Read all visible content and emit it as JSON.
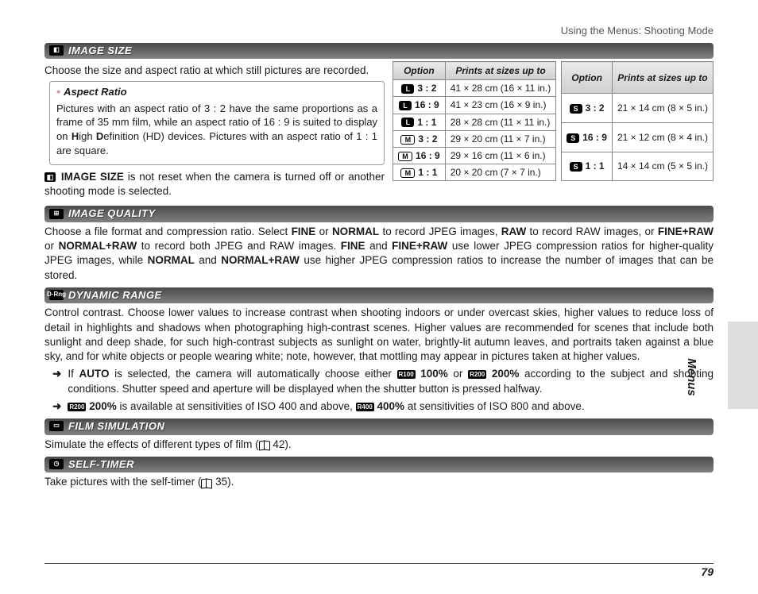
{
  "header": {
    "breadcrumb": "Using the Menus: Shooting Mode"
  },
  "side_tab": "Menus",
  "page_number": "79",
  "sections": {
    "image_size": {
      "title": "IMAGE SIZE",
      "intro": "Choose the size and aspect ratio at which still pictures are recorded.",
      "callout": {
        "title": "Aspect Ratio",
        "body_parts": [
          "Pictures with an aspect ratio of 3 : 2 have the same proportions as a frame of 35 mm film, while an aspect ratio of 16 : 9 is suited to display on ",
          "H",
          "igh ",
          "D",
          "efinition (HD) devices.  Pictures with an aspect ratio of 1 : 1 are square."
        ]
      },
      "note_prefix_bold": "IMAGE SIZE",
      "note_rest": " is not reset when the camera is turned off or another shooting mode is selected.",
      "table1": {
        "h1": "Option",
        "h2": "Prints at sizes up to",
        "rows": [
          {
            "b": "L",
            "bstyle": "white",
            "r": "3 : 2",
            "v": "41 × 28 cm (16 × 11 in.)"
          },
          {
            "b": "L",
            "bstyle": "white",
            "r": "16 : 9",
            "v": "41 × 23 cm (16 × 9 in.)"
          },
          {
            "b": "L",
            "bstyle": "white",
            "r": "1 : 1",
            "v": "28 × 28 cm (11 × 11 in.)"
          },
          {
            "b": "M",
            "bstyle": "m",
            "r": "3 : 2",
            "v": "29 × 20 cm (11 × 7 in.)"
          },
          {
            "b": "M",
            "bstyle": "m",
            "r": "16 : 9",
            "v": "29 × 16 cm (11 × 6 in.)"
          },
          {
            "b": "M",
            "bstyle": "m",
            "r": "1 : 1",
            "v": "20 × 20 cm (7 × 7 in.)"
          }
        ]
      },
      "table2": {
        "h1": "Option",
        "h2": "Prints at sizes up to",
        "rows": [
          {
            "b": "S",
            "bstyle": "white",
            "r": "3 : 2",
            "v": "21 × 14 cm (8 × 5 in.)"
          },
          {
            "b": "S",
            "bstyle": "white",
            "r": "16 : 9",
            "v": "21 × 12 cm (8 × 4 in.)"
          },
          {
            "b": "S",
            "bstyle": "white",
            "r": "1 : 1",
            "v": "14 × 14 cm (5 × 5 in.)"
          }
        ]
      }
    },
    "image_quality": {
      "title": "IMAGE QUALITY",
      "p": [
        "Choose a file format and compression ratio.  Select ",
        "FINE",
        " or ",
        "NORMAL",
        " to record JPEG images, ",
        "RAW",
        " to record RAW images, or ",
        "FINE+RAW",
        " or ",
        "NORMAL+RAW",
        " to record both JPEG and RAW images.  ",
        "FINE",
        " and ",
        "FINE+RAW",
        " use lower JPEG compression ratios for higher-quality JPEG images, while ",
        "NORMAL",
        " and ",
        "NORMAL+RAW",
        " use higher JPEG compression ratios to increase the number of images that can be stored."
      ]
    },
    "dynamic_range": {
      "title": "DYNAMIC RANGE",
      "p1": "Control contrast.  Choose lower values to increase contrast when shooting indoors or under overcast skies, higher values to reduce loss of detail in highlights and shadows when photographing high-contrast scenes.  Higher values are recommended for scenes that include both sunlight and deep shade, for such high-contrast subjects as sunlight on water, brightly-lit autumn leaves, and portraits taken against a blue sky, and for white objects or people wearing white; note, however, that mottling may appear in pictures taken at higher values.",
      "b1": {
        "pre": "If ",
        "auto": "AUTO",
        "mid": " is selected, the camera will automatically choose either ",
        "r100": "R100",
        "p100": " 100%",
        "or": " or ",
        "r200": "R200",
        "p200": " 200%",
        "post": " according to the subject and shooting conditions. Shutter speed and aperture will be displayed when the shutter button is pressed halfway."
      },
      "b2": {
        "r200": "R200",
        "p200": " 200%",
        "mid": " is available at sensitivities of ISO 400 and above, ",
        "r400": "R400",
        "p400": " 400%",
        "post": " at sensitivities of ISO 800 and above."
      }
    },
    "film_sim": {
      "title": "FILM SIMULATION",
      "body_pre": "Simulate the effects of different types of film (",
      "page": " 42).",
      "body_post": ""
    },
    "self_timer": {
      "title": "SELF-TIMER",
      "body_pre": "Take pictures with the self-timer (",
      "page": " 35).",
      "body_post": ""
    }
  }
}
